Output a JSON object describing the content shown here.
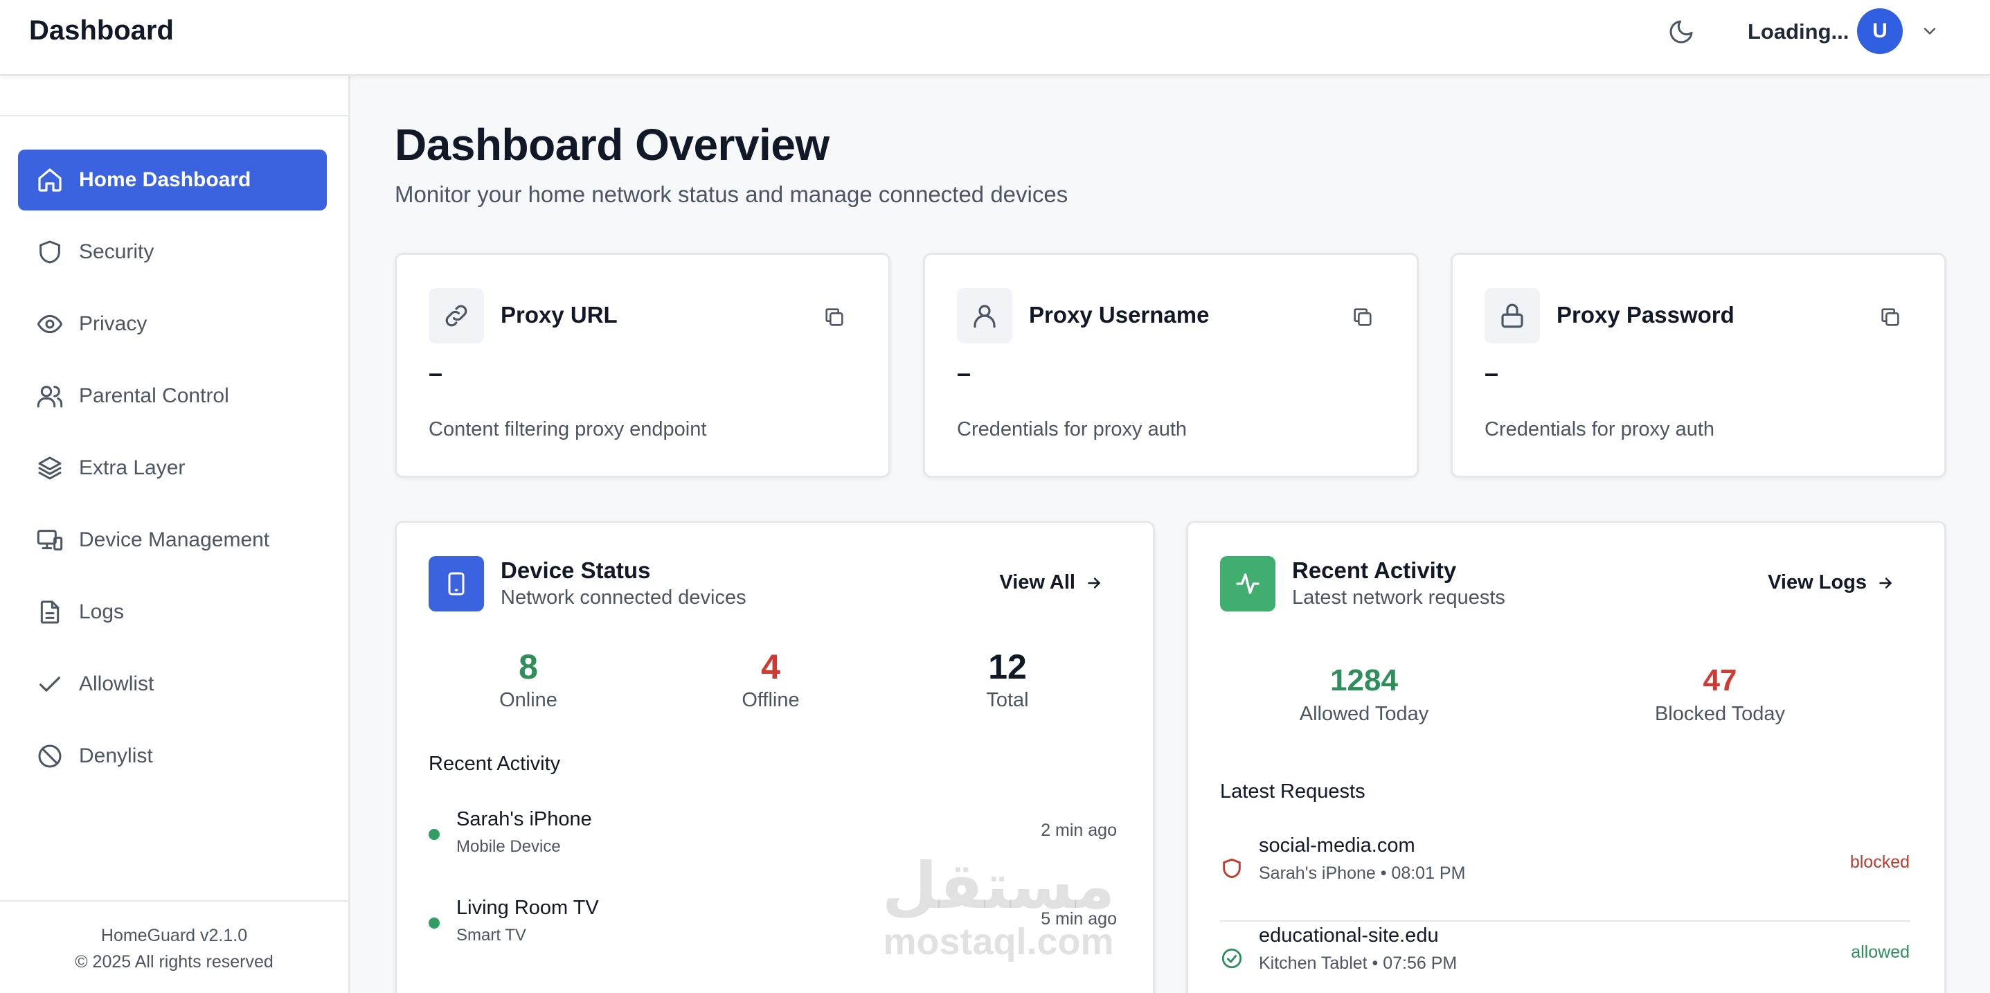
{
  "header": {
    "title": "Dashboard",
    "status": "Loading...",
    "avatar_initial": "U"
  },
  "sidebar": {
    "items": [
      {
        "label": "Home Dashboard",
        "icon": "home-icon",
        "active": true
      },
      {
        "label": "Security",
        "icon": "shield-icon"
      },
      {
        "label": "Privacy",
        "icon": "eye-icon"
      },
      {
        "label": "Parental Control",
        "icon": "users-icon"
      },
      {
        "label": "Extra Layer",
        "icon": "layers-icon"
      },
      {
        "label": "Device Management",
        "icon": "devices-icon"
      },
      {
        "label": "Logs",
        "icon": "file-icon"
      },
      {
        "label": "Allowlist",
        "icon": "check-icon"
      },
      {
        "label": "Denylist",
        "icon": "ban-icon"
      }
    ],
    "footer": {
      "version": "HomeGuard v2.1.0",
      "copyright": "© 2025 All rights reserved"
    }
  },
  "page": {
    "title": "Dashboard Overview",
    "subtitle": "Monitor your home network status and manage connected devices"
  },
  "proxy_cards": [
    {
      "title": "Proxy URL",
      "value": "–",
      "description": "Content filtering proxy endpoint",
      "icon": "link-icon"
    },
    {
      "title": "Proxy Username",
      "value": "–",
      "description": "Credentials for proxy auth",
      "icon": "user-icon"
    },
    {
      "title": "Proxy Password",
      "value": "–",
      "description": "Credentials for proxy auth",
      "icon": "lock-icon"
    }
  ],
  "device_status": {
    "title": "Device Status",
    "subtitle": "Network connected devices",
    "link": "View All",
    "stats": [
      {
        "value": "8",
        "label": "Online",
        "color": "#2f8f5b"
      },
      {
        "value": "4",
        "label": "Offline",
        "color": "#d13a32"
      },
      {
        "value": "12",
        "label": "Total",
        "color": "#111827"
      }
    ],
    "recent_label": "Recent Activity",
    "devices": [
      {
        "name": "Sarah's iPhone",
        "type": "Mobile Device",
        "time": "2 min ago"
      },
      {
        "name": "Living Room TV",
        "type": "Smart TV",
        "time": "5 min ago"
      }
    ]
  },
  "recent_activity": {
    "title": "Recent Activity",
    "subtitle": "Latest network requests",
    "link": "View Logs",
    "stats": [
      {
        "value": "1284",
        "label": "Allowed Today",
        "color": "#2f8f5b"
      },
      {
        "value": "47",
        "label": "Blocked Today",
        "color": "#d13a32"
      }
    ],
    "latest_label": "Latest Requests",
    "requests": [
      {
        "domain": "social-media.com",
        "meta": "Sarah's iPhone • 08:01 PM",
        "status": "blocked",
        "color": "#c0392b"
      },
      {
        "domain": "educational-site.edu",
        "meta": "Kitchen Tablet • 07:56 PM",
        "status": "allowed",
        "color": "#2f8f5b"
      }
    ]
  },
  "watermark": {
    "line1": "مستقل",
    "line2": "mostaql.com"
  },
  "colors": {
    "accent": "#3b63e0",
    "green": "#2f8f5b",
    "red": "#d13a32"
  }
}
